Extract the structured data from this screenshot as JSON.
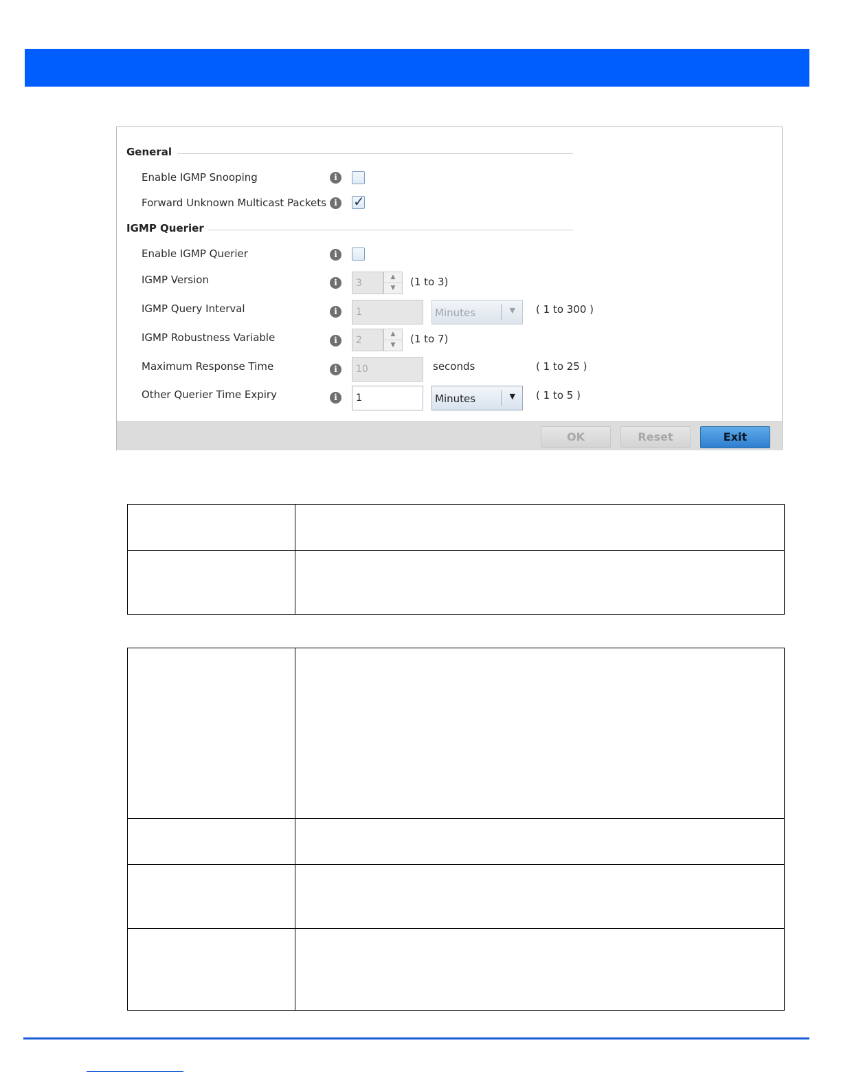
{
  "dialog": {
    "general": {
      "heading": "General",
      "enable_snooping": {
        "label": "Enable IGMP Snooping",
        "checked": false
      },
      "forward_unknown": {
        "label": "Forward Unknown Multicast Packets",
        "checked": true
      }
    },
    "querier": {
      "heading": "IGMP Querier",
      "enable_querier": {
        "label": "Enable IGMP Querier",
        "checked": false
      },
      "version": {
        "label": "IGMP Version",
        "value": "3",
        "range": "(1 to 3)"
      },
      "query_interval": {
        "label": "IGMP Query Interval",
        "value": "1",
        "unit": "Minutes",
        "range": "( 1 to 300 )"
      },
      "robustness": {
        "label": "IGMP Robustness Variable",
        "value": "2",
        "range": "(1 to 7)"
      },
      "max_response": {
        "label": "Maximum Response Time",
        "value": "10",
        "unit": "seconds",
        "range": "( 1 to 25 )"
      },
      "other_expiry": {
        "label": "Other Querier Time Expiry",
        "value": "1",
        "unit": "Minutes",
        "range": "( 1 to 5 )"
      }
    },
    "info_glyph": "i",
    "footer": {
      "ok_label": "OK",
      "reset_label": "Reset",
      "exit_label": "Exit"
    }
  },
  "icons": {
    "info": "info-icon",
    "check": "checkmark-icon",
    "spin_up": "chevron-up-icon",
    "spin_down": "chevron-down-icon",
    "dropdown": "triangle-down-icon"
  },
  "colors": {
    "banner": "#005eff",
    "exit_button": "#2f7fd0",
    "rule": "#1a5fd6"
  }
}
